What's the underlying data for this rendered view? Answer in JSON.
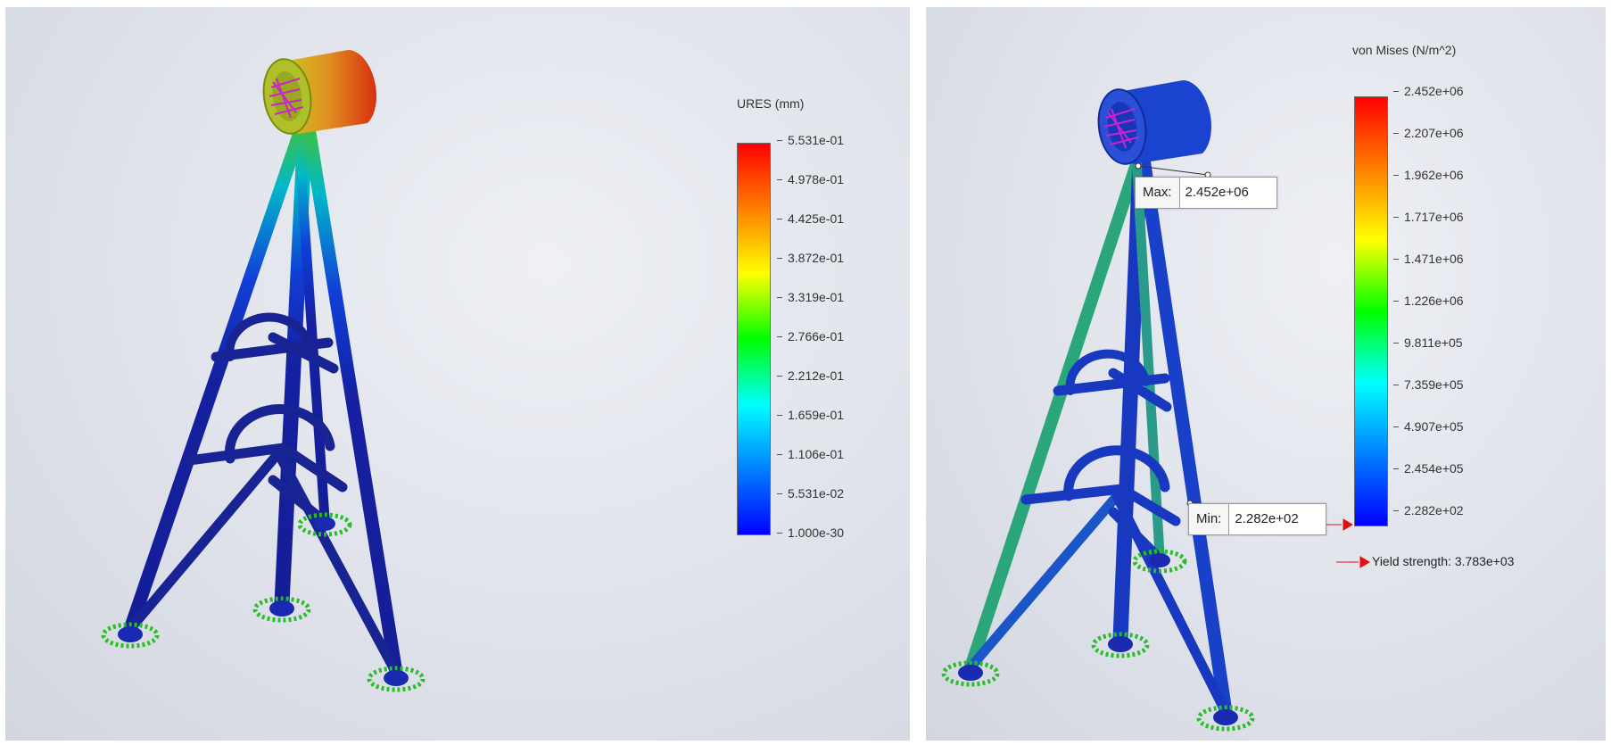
{
  "left_plot": {
    "legend_title": "URES (mm)",
    "ticks": [
      "5.531e-01",
      "4.978e-01",
      "4.425e-01",
      "3.872e-01",
      "3.319e-01",
      "2.766e-01",
      "2.212e-01",
      "1.659e-01",
      "1.106e-01",
      "5.531e-02",
      "1.000e-30"
    ]
  },
  "right_plot": {
    "legend_title": "von Mises (N/m^2)",
    "ticks": [
      "2.452e+06",
      "2.207e+06",
      "1.962e+06",
      "1.717e+06",
      "1.471e+06",
      "1.226e+06",
      "9.811e+05",
      "7.359e+05",
      "4.907e+05",
      "2.454e+05",
      "2.282e+02"
    ],
    "max_probe": {
      "label": "Max:",
      "value": "2.452e+06"
    },
    "min_probe": {
      "label": "Min:",
      "value": "2.282e+02"
    },
    "yield_label": "Yield strength: 3.783e+03"
  },
  "colors": {
    "rainbow": [
      "#ff0000",
      "#ff7f00",
      "#ffff00",
      "#00ff00",
      "#00ffff",
      "#0080ff",
      "#0000ff"
    ],
    "frame_blue": "#1a2a9a",
    "fixture_green": "#26c026",
    "load_magenta": "#d020d0"
  }
}
